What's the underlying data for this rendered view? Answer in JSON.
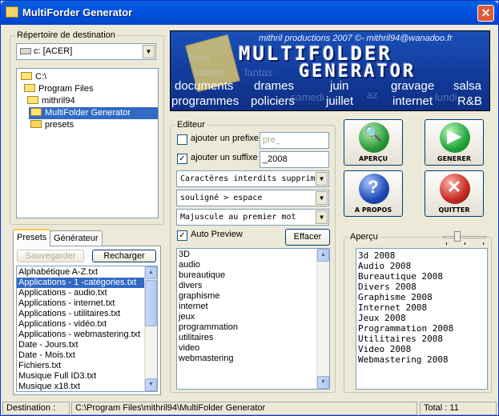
{
  "window": {
    "title": "MultiForder Generator",
    "close_label": "✕"
  },
  "destination": {
    "group_label": "Répertoire de destination",
    "drive_value": "c: [ACER]",
    "tree": [
      {
        "label": "C:\\",
        "level": 0,
        "selected": false
      },
      {
        "label": "Program Files",
        "level": 1,
        "selected": false
      },
      {
        "label": "mithril94",
        "level": 2,
        "selected": false
      },
      {
        "label": "MultiFolder Generator",
        "level": 3,
        "selected": true
      },
      {
        "label": "presets",
        "level": 4,
        "selected": false
      }
    ]
  },
  "banner": {
    "credit": "mithril productions 2007 ©- mithril94@wanadoo.fr",
    "logo_line1": "MULTIFOLDER",
    "logo_line2": "GENERATOR",
    "words": [
      "documents",
      "drames",
      "juin",
      "gravage",
      "salsa",
      "programmes",
      "policiers",
      "juillet",
      "internet",
      "R&B"
    ],
    "faint_words": [
      "films",
      "vidéos",
      "fantas",
      "samedi",
      "lundi",
      "az"
    ]
  },
  "editor": {
    "group_label": "Editeur",
    "prefix": {
      "label": "ajouter un prefixe",
      "checked": false,
      "value": "pre_"
    },
    "suffix": {
      "label": "ajouter un suffixe",
      "checked": true,
      "value": "_2008"
    },
    "combos": [
      "Caractères interdits supprimés :",
      "souligné > espace",
      "Majuscule au premier mot"
    ],
    "auto_preview": {
      "label": "Auto Preview",
      "checked": true
    },
    "clear_button": "Effacer",
    "lines": [
      "3D",
      "audio",
      "bureautique",
      "divers",
      "graphisme",
      "internet",
      "jeux",
      "programmation",
      "utilitaires",
      "video",
      "webmastering"
    ]
  },
  "actions": {
    "preview": {
      "label": "APERÇU",
      "color": "#2a9a3a"
    },
    "generate": {
      "label": "GENERER",
      "color": "#21a63c"
    },
    "about": {
      "label": "A PROPOS",
      "color": "#1e4ab8"
    },
    "quit": {
      "label": "QUITTER",
      "color": "#c42a22"
    }
  },
  "apercu": {
    "group_label": "Aperçu",
    "slider_level": 0.3,
    "items": [
      "3d 2008",
      "Audio 2008",
      "Bureautique 2008",
      "Divers 2008",
      "Graphisme 2008",
      "Internet 2008",
      "Jeux 2008",
      "Programmation 2008",
      "Utilitaires 2008",
      "Video 2008",
      "Webmastering 2008"
    ]
  },
  "presets": {
    "tabs": [
      "Presets",
      "Générateur"
    ],
    "save_button": "Sauvegarder",
    "reload_button": "Recharger",
    "items": [
      {
        "label": "Alphabétique A-Z.txt",
        "selected": false
      },
      {
        "label": "Applications - 1 -catégories.txt",
        "selected": true
      },
      {
        "label": "Applications - audio.txt",
        "selected": false
      },
      {
        "label": "Applications - internet.txt",
        "selected": false
      },
      {
        "label": "Applications - utilitaires.txt",
        "selected": false
      },
      {
        "label": "Applications - vidéo.txt",
        "selected": false
      },
      {
        "label": "Applications - webmastering.txt",
        "selected": false
      },
      {
        "label": "Date - Jours.txt",
        "selected": false
      },
      {
        "label": "Date - Mois.txt",
        "selected": false
      },
      {
        "label": "Fichiers.txt",
        "selected": false
      },
      {
        "label": "Musique Full ID3.txt",
        "selected": false
      },
      {
        "label": "Musique x18.txt",
        "selected": false
      }
    ]
  },
  "status": {
    "destination_label": "Destination :",
    "destination_path": "C:\\Program Files\\mithril94\\MultiFolder Generator",
    "total": "Total : 11"
  }
}
